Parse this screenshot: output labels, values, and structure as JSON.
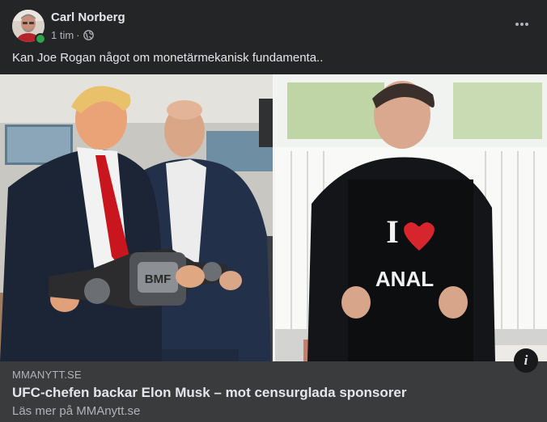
{
  "post": {
    "author": "Carl Norberg",
    "time": "1 tim",
    "separator": "·",
    "privacy_icon": "globe-icon",
    "more_icon": "more-options-icon",
    "text": "Kan Joe Rogan något om monetärmekanisk fundamenta.."
  },
  "image": {
    "left_panel_shirt_text": "",
    "right_panel_shirt_letter": "I",
    "right_panel_shirt_text": "ANAL",
    "belt_text": "BMF"
  },
  "link_preview": {
    "domain": "MMANYTT.SE",
    "title": "UFC-chefen backar Elon Musk – mot censurglada sponsorer",
    "subtitle": "Läs mer på MMAnytt.se",
    "info_icon_label": "i"
  },
  "colors": {
    "background": "#242526",
    "link_box": "#3a3b3c",
    "primary_text": "#e4e6eb",
    "secondary_text": "#b0b3b8",
    "online": "#31a24c"
  }
}
